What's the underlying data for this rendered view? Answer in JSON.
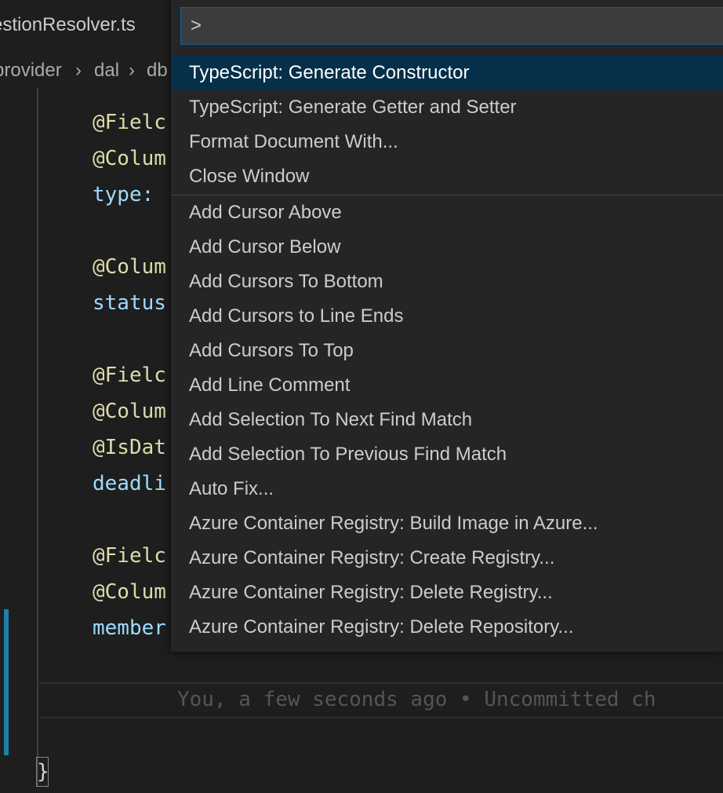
{
  "tab": {
    "title": "estionResolver.ts"
  },
  "breadcrumb": {
    "items": [
      "provider",
      "dal",
      "db"
    ]
  },
  "editor": {
    "lines": [
      {
        "text": "@Fielc",
        "kind": "deco"
      },
      {
        "text": "@Colum",
        "kind": "deco"
      },
      {
        "text": "type: ",
        "kind": "prop"
      },
      {
        "text": "@Colum",
        "kind": "deco"
      },
      {
        "text": "status",
        "kind": "prop"
      },
      {
        "text": "@Fielc",
        "kind": "deco"
      },
      {
        "text": "@Colum",
        "kind": "deco"
      },
      {
        "text": "@IsDat",
        "kind": "deco"
      },
      {
        "text": "deadli",
        "kind": "prop"
      },
      {
        "text": "@Fielc",
        "kind": "deco"
      },
      {
        "text": "@Colum",
        "kind": "deco"
      },
      {
        "text": "member",
        "kind": "prop"
      }
    ],
    "blame": "You, a few seconds ago • Uncommitted ch",
    "closing_brace": "}"
  },
  "palette": {
    "input_value": ">",
    "items": [
      "TypeScript: Generate Constructor",
      "TypeScript: Generate Getter and Setter",
      "Format Document With...",
      "Close Window",
      "Add Cursor Above",
      "Add Cursor Below",
      "Add Cursors To Bottom",
      "Add Cursors to Line Ends",
      "Add Cursors To Top",
      "Add Line Comment",
      "Add Selection To Next Find Match",
      "Add Selection To Previous Find Match",
      "Auto Fix...",
      "Azure Container Registry: Build Image in Azure...",
      "Azure Container Registry: Create Registry...",
      "Azure Container Registry: Delete Registry...",
      "Azure Container Registry: Delete Repository..."
    ],
    "selected_index": 0
  },
  "colors": {
    "accent": "#0e639c",
    "selection": "#062f4a",
    "git_modified": "#1b81a8"
  }
}
